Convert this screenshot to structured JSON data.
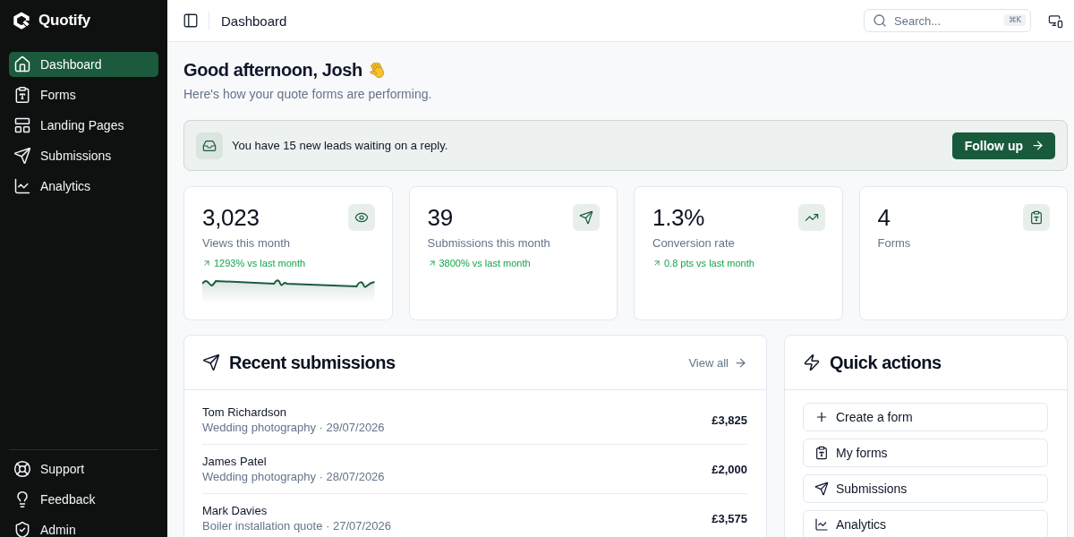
{
  "sidebar": {
    "brand": "Quotify",
    "items": [
      {
        "label": "Dashboard",
        "selected": true
      },
      {
        "label": "Forms",
        "selected": false
      },
      {
        "label": "Landing Pages",
        "selected": false
      },
      {
        "label": "Submissions",
        "selected": false
      },
      {
        "label": "Analytics",
        "selected": false
      }
    ],
    "footer_items": [
      {
        "label": "Support",
        "selected": false
      },
      {
        "label": "Feedback",
        "selected": false
      },
      {
        "label": "Admin",
        "selected": false
      }
    ]
  },
  "top_bar": {
    "title": "Dashboard",
    "search": {
      "placeholder": "Search...",
      "shortcut": "⌘K"
    }
  },
  "greeting": {
    "title": "Good afternoon, Josh",
    "subtitle": "Here's how your quote forms are performing."
  },
  "alert": {
    "message": "You have 15 new leads waiting on a reply.",
    "action": "Follow up"
  },
  "stats": [
    {
      "value": "3,023",
      "label": "Views this month",
      "trend": "1293% vs last month",
      "sparkline": true
    },
    {
      "value": "39",
      "label": "Submissions this month",
      "trend": "3800% vs last month",
      "sparkline": false
    },
    {
      "value": "1.3%",
      "label": "Conversion rate",
      "trend": "0.8 pts vs last month",
      "sparkline": false
    },
    {
      "value": "4",
      "label": "Forms",
      "sparkline": false
    }
  ],
  "recent_submissions": {
    "title": "Recent submissions",
    "link": "View all",
    "rows": [
      {
        "name": "Tom Richardson",
        "detail": "Wedding photography · 29/07/2026",
        "amount": "£3,825"
      },
      {
        "name": "James Patel",
        "detail": "Wedding photography · 28/07/2026",
        "amount": "£2,000"
      },
      {
        "name": "Mark Davies",
        "detail": "Boiler installation quote · 27/07/2026",
        "amount": "£3,575"
      }
    ]
  },
  "quick_actions": {
    "title": "Quick actions",
    "items": [
      "Create a form",
      "My forms",
      "Submissions",
      "Analytics"
    ]
  }
}
